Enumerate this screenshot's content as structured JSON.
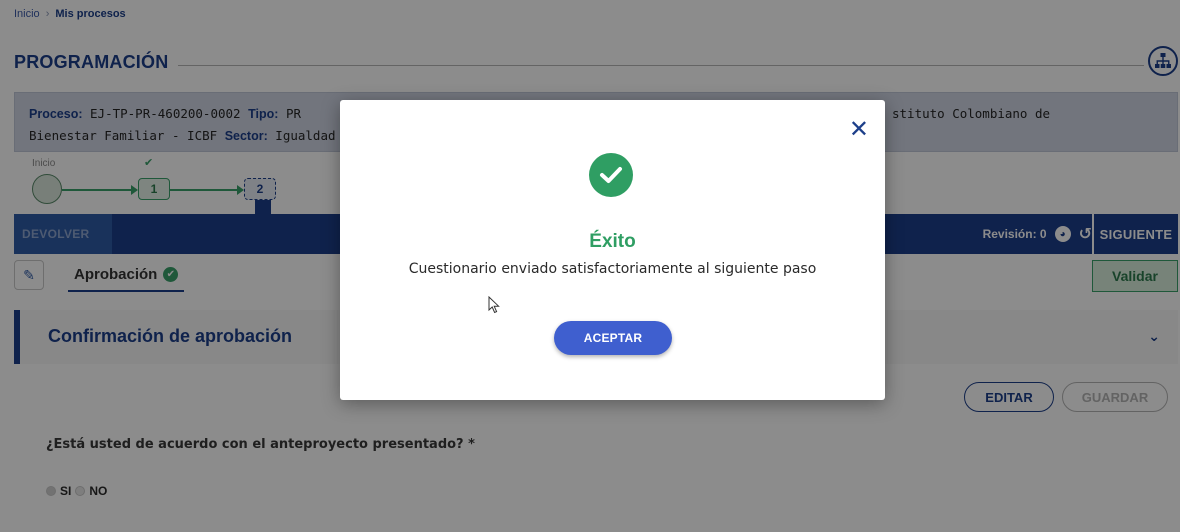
{
  "breadcrumb": {
    "home": "Inicio",
    "separator": "›",
    "current": "Mis procesos"
  },
  "page": {
    "title": "PROGRAMACIÓN"
  },
  "info": {
    "proceso_label": "Proceso:",
    "proceso_value": "EJ-TP-PR-460200-0002",
    "tipo_label": "Tipo:",
    "tipo_value": "PR",
    "entidad_tail": "stituto Colombiano de",
    "line2_value": "Bienestar Familiar - ICBF",
    "sector_label": "Sector:",
    "sector_value": "Igualdad"
  },
  "stepper": {
    "start_label": "Inicio",
    "step1": "1",
    "step2": "2",
    "done_mark": "✔"
  },
  "action_bar": {
    "devolver": "DEVOLVER",
    "revision": "Revisión: 0",
    "siguiente": "SIGUIENTE"
  },
  "tabs": {
    "aprobacion": "Aprobación",
    "validar": "Validar"
  },
  "section": {
    "title": "Confirmación de aprobación"
  },
  "form": {
    "editar": "EDITAR",
    "guardar": "GUARDAR",
    "question": "¿Está usted de acuerdo con el anteproyecto presentado? *",
    "option_si": "SI",
    "option_no": "NO"
  },
  "modal": {
    "close": "✕",
    "heading": "Éxito",
    "message": "Cuestionario enviado satisfactoriamente al siguiente paso",
    "accept": "ACEPTAR"
  },
  "colors": {
    "primary": "#1d3f8a",
    "success": "#2f9e63",
    "accept_button": "#3f5fcf"
  },
  "icons": {
    "sitemap": "sitemap-icon",
    "pencil": "pencil-icon",
    "check": "check-circle-icon",
    "history": "history-icon",
    "pdf": "pdf-icon"
  }
}
